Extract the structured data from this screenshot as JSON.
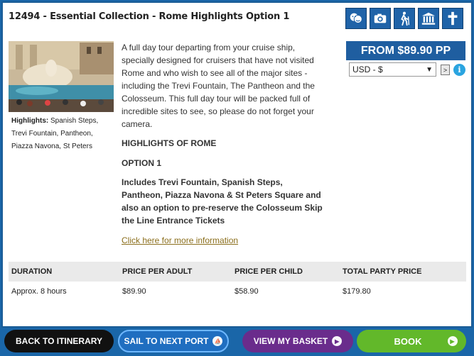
{
  "tour": {
    "title": "12494 - Essential Collection - Rome Highlights Option 1",
    "highlights_label": "Highlights:",
    "highlights_text": "Spanish Steps, Trevi Fountain, Pantheon, Piazza Navona, St Peters",
    "description": "A full day tour departing from your cruise ship, specially designed for cruisers that have not visited Rome and who wish to see all of the major sites - including the Trevi Fountain, The Pantheon and the Colosseum.  This full day tour will be packed full of incredible sites to see, so please do not forget your camera.",
    "subheading_1": "HIGHLIGHTS OF ROME",
    "subheading_2": "OPTION 1",
    "includes": "Includes Trevi Fountain, Spanish Steps, Pantheon, Piazza Navona & St Peters Square and also an option to pre-reserve the Colosseum Skip the Line Entrance Tickets",
    "more_link": "Click here for more information"
  },
  "icons": [
    "theatre-masks-icon",
    "camera-icon",
    "hiking-icon",
    "museum-icon",
    "church-cross-icon"
  ],
  "pricing": {
    "from_label": "FROM $89.90 PP",
    "currency_selected": "USD - $",
    "go_label": ">"
  },
  "table": {
    "headers": [
      "DURATION",
      "PRICE PER ADULT",
      "PRICE PER CHILD",
      "TOTAL PARTY PRICE"
    ],
    "row": [
      "Approx. 8 hours",
      "$89.90",
      "$58.90",
      "$179.80"
    ]
  },
  "nav": {
    "back": "BACK TO ITINERARY",
    "sail": "SAIL TO NEXT PORT",
    "basket": "VIEW MY BASKET",
    "book": "BOOK"
  },
  "colors": {
    "brand_blue": "#1f5ea0",
    "book_green": "#62b82a",
    "basket_purple": "#6a2c8c"
  }
}
